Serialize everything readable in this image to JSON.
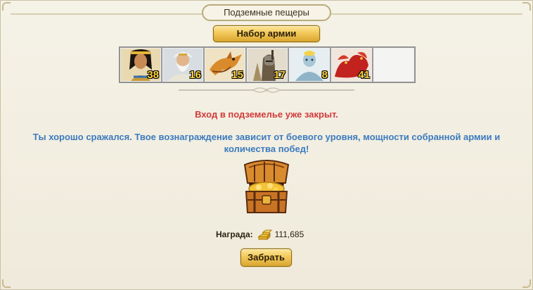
{
  "title": "Подземные пещеры",
  "army_button": "Набор армии",
  "units": [
    {
      "name": "cleopatra-unit",
      "count": "38",
      "icon": "egyptian-queen-icon"
    },
    {
      "name": "sage-unit",
      "count": "16",
      "icon": "white-bearded-sage-icon"
    },
    {
      "name": "dragon-unit",
      "count": "15",
      "icon": "golden-dragon-icon"
    },
    {
      "name": "knight-unit",
      "count": "17",
      "icon": "armored-knight-icon"
    },
    {
      "name": "golem-unit",
      "count": "8",
      "icon": "ice-golem-icon"
    },
    {
      "name": "hydra-unit",
      "count": "41",
      "icon": "red-hydra-icon"
    }
  ],
  "messages": {
    "closed": "Вход в подземелье уже закрыт.",
    "reward_info": "Ты хорошо сражался. Твое вознаграждение зависит от боевого уровня, мощности собранной армии и количества побед!"
  },
  "reward": {
    "label": "Награда:",
    "amount": "111,685",
    "icon": "gold-bars-icon"
  },
  "take_button": "Забрать",
  "colors": {
    "closed_text": "#d23a3a",
    "info_text": "#3b7bbf",
    "gold_button": "#f2c85a"
  }
}
